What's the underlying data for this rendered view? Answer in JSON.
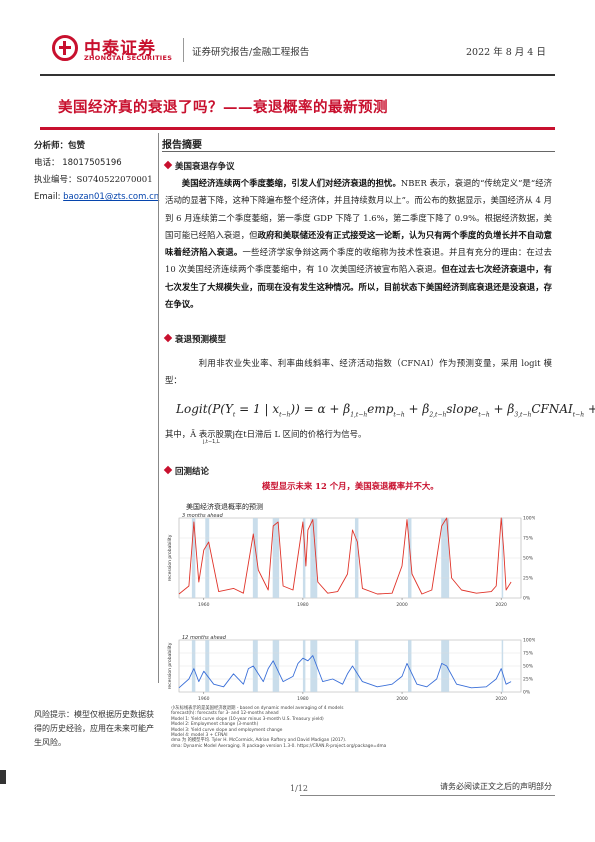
{
  "header": {
    "logo_name": "中泰证券",
    "logo_sub": "ZHONGTAI SECURITIES",
    "report_type": "证券研究报告/金融工程报告",
    "date": "2022 年 8 月 4 日"
  },
  "title": "美国经济真的衰退了吗？——衰退概率的最新预测",
  "analyst": {
    "label": "分析师：包赞",
    "phone": "电话： 18017505196",
    "license": "执业编号：S0740522070001",
    "email_label": "Email:",
    "email": "baozan01@zts.com.cn"
  },
  "summary_heading": "报告摘要",
  "sections": {
    "s1_title": "美国衰退存争议",
    "s2_title": "衰退预测模型",
    "s3_title": "回测结论"
  },
  "p1": {
    "bold1": "美国经济连续两个季度萎缩，引发人们对经济衰退的担忧。",
    "t1": "NBER 表示，衰退的“传统定义”是“经济活动的显著下降，这种下降遍布整个经济体，并且持续数月以上”。而公布的数据显示，美国经济从 4 月到 6 月连续第二个季度萎缩，第一季度 GDP 下降了 1.6%，第二季度下降了 0.9%。根据经济数据，美国可能已经陷入衰退，但",
    "bold2": "政府和美联储还没有正式接受这一论断，认为只有两个季度的负增长并不自动意味着经济陷入衰退。",
    "t2": "一些经济学家争辩这两个季度的收缩称为技术性衰退。并且有充分的理由：在过去 10 次美国经济连续两个季度萎缩中，有 10 次美国经济被宣布陷入衰退。",
    "bold3": "但在过去七次经济衰退中，有七次发生了大规模失业，而现在没有发生这种情况。所以，目前状态下美国经济到底衰退还是没衰退，存在争议。"
  },
  "p2": "利用非农业失业率、利率曲线斜率、经济活动指数（CFNAI）作为预测变量，采用 logit 模型：",
  "formula": {
    "lhs": "Logit(P(Y",
    "mid": " = 1 | x",
    "rhs": ")) = α + β",
    "emp": "emp",
    "slope": "slope",
    "cfnai": "CFNAI",
    "eps": "+ ε"
  },
  "formula_note": "其中，Ā 表示股票j在t日滞后 L 区间的价格行为信号。",
  "formula_note_sub": "j,t−1,L",
  "conclusion_caption": "模型显示未来 12 个月，美国衰退概率并不大。",
  "chart_title": "美国经济衰退概率的预测",
  "chart_data": [
    {
      "type": "line",
      "title": "美国经济衰退概率的预测",
      "subtitle": "3 months ahead",
      "ylabel": "recession probability",
      "y_ticks": [
        "0%",
        "25%",
        "50%",
        "75%",
        "100%"
      ],
      "x_ticks": [
        "1960",
        "1980",
        "2000",
        "2020"
      ],
      "ylim": [
        0,
        100
      ],
      "xlim": [
        1955,
        2024
      ],
      "color": "#e0342a",
      "series": [
        {
          "x": [
            1955,
            1957,
            1958,
            1959,
            1960,
            1961,
            1963,
            1966,
            1968,
            1970,
            1971,
            1973,
            1974,
            1975,
            1976,
            1978,
            1980,
            1980.6,
            1981,
            1982,
            1983,
            1985,
            1987,
            1989,
            1990,
            1991,
            1992,
            1995,
            1998,
            2000,
            2001,
            2002,
            2004,
            2006,
            2008,
            2009,
            2010,
            2012,
            2015,
            2018,
            2019,
            2020,
            2020.5,
            2021,
            2022
          ],
          "values": [
            5,
            15,
            95,
            20,
            60,
            70,
            8,
            12,
            6,
            80,
            35,
            10,
            90,
            95,
            15,
            10,
            95,
            40,
            85,
            98,
            20,
            6,
            8,
            30,
            85,
            70,
            12,
            5,
            6,
            40,
            98,
            30,
            5,
            10,
            90,
            100,
            25,
            10,
            6,
            8,
            15,
            100,
            60,
            10,
            20
          ]
        }
      ]
    },
    {
      "type": "line",
      "subtitle": "12 months ahead",
      "ylabel": "recession probability",
      "y_ticks": [
        "0%",
        "25%",
        "50%",
        "75%",
        "100%"
      ],
      "x_ticks": [
        "1960",
        "1980",
        "2000",
        "2020"
      ],
      "ylim": [
        0,
        100
      ],
      "xlim": [
        1955,
        2024
      ],
      "color": "#3a6fd8",
      "series": [
        {
          "x": [
            1955,
            1957,
            1958,
            1959,
            1960,
            1962,
            1964,
            1966,
            1968,
            1969,
            1970,
            1972,
            1973,
            1974,
            1976,
            1978,
            1979,
            1980,
            1981,
            1982,
            1984,
            1986,
            1988,
            1989,
            1990,
            1992,
            1995,
            1998,
            2000,
            2001,
            2003,
            2005,
            2007,
            2008,
            2009,
            2011,
            2014,
            2017,
            2019,
            2020,
            2021,
            2022
          ],
          "values": [
            8,
            25,
            45,
            20,
            40,
            15,
            10,
            35,
            15,
            45,
            50,
            20,
            45,
            60,
            20,
            30,
            55,
            65,
            60,
            70,
            20,
            25,
            15,
            35,
            50,
            20,
            10,
            15,
            30,
            55,
            15,
            10,
            25,
            55,
            50,
            15,
            8,
            10,
            25,
            45,
            15,
            20
          ]
        }
      ]
    }
  ],
  "recession_bands": [
    [
      1957.6,
      1958.3
    ],
    [
      1960.3,
      1961.1
    ],
    [
      1969.9,
      1970.9
    ],
    [
      1973.9,
      1975.2
    ],
    [
      1980.0,
      1980.5
    ],
    [
      1981.5,
      1982.9
    ],
    [
      1990.5,
      1991.2
    ],
    [
      2001.2,
      2001.9
    ],
    [
      2007.9,
      2009.5
    ],
    [
      2020.1,
      2020.4
    ]
  ],
  "chart_note": [
    "小灰标线表示的是美国经济衰退期 - based on dynamic model averaging of 4 models",
    "forecast(h): forecasts for 3- and 12-months ahead",
    "Model 1: Yield curve slope (10-year minus 3-month U.S. Treasury yield)",
    "Model 2: Employment change (3-month)",
    "Model 3: Yield curve slope and employment change",
    "Model 4: model 3 + CFNAI",
    "dma 为 的模型平均. Tyler H. McCormick, Adrian Raftery and David Madigan (2017).",
    "dma: Dynamic Model Averaging. R package version 1.3-0. https://CRAN.R-project.org/package=dma"
  ],
  "risk": "风险提示：模型仅根据历史数据获得的历史经验，应用在未来可能产生风险。",
  "footer": {
    "page": "1/12",
    "disclaimer": "请务必阅读正文之后的声明部分"
  }
}
